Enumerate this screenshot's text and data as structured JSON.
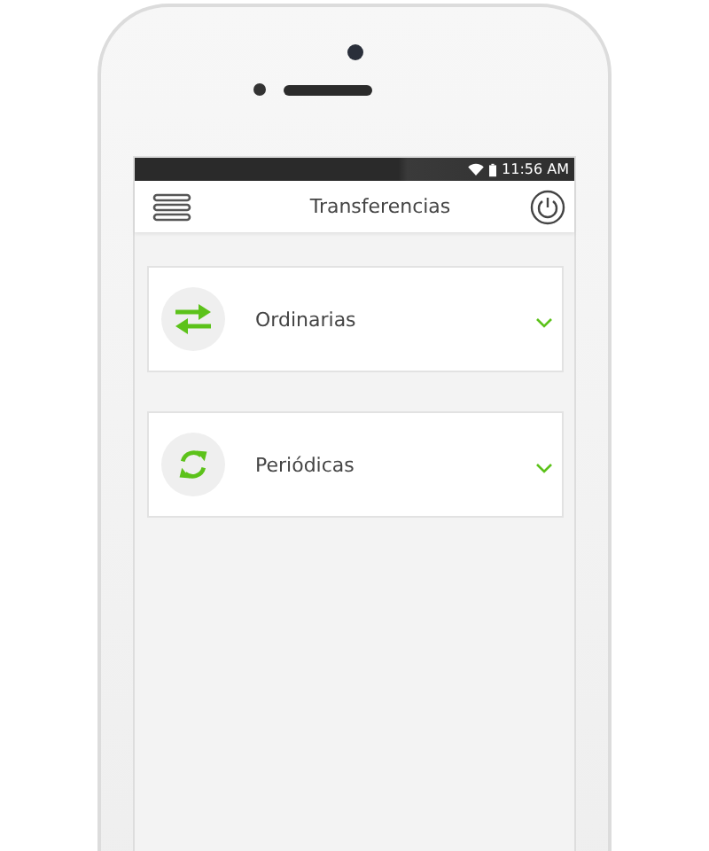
{
  "status_bar": {
    "time": "11:56 AM"
  },
  "header": {
    "title": "Transferencias"
  },
  "items": [
    {
      "kind": "swap",
      "label": "Ordinarias",
      "expanded": false
    },
    {
      "kind": "repeat",
      "label": "Periódicas",
      "expanded": false
    }
  ]
}
